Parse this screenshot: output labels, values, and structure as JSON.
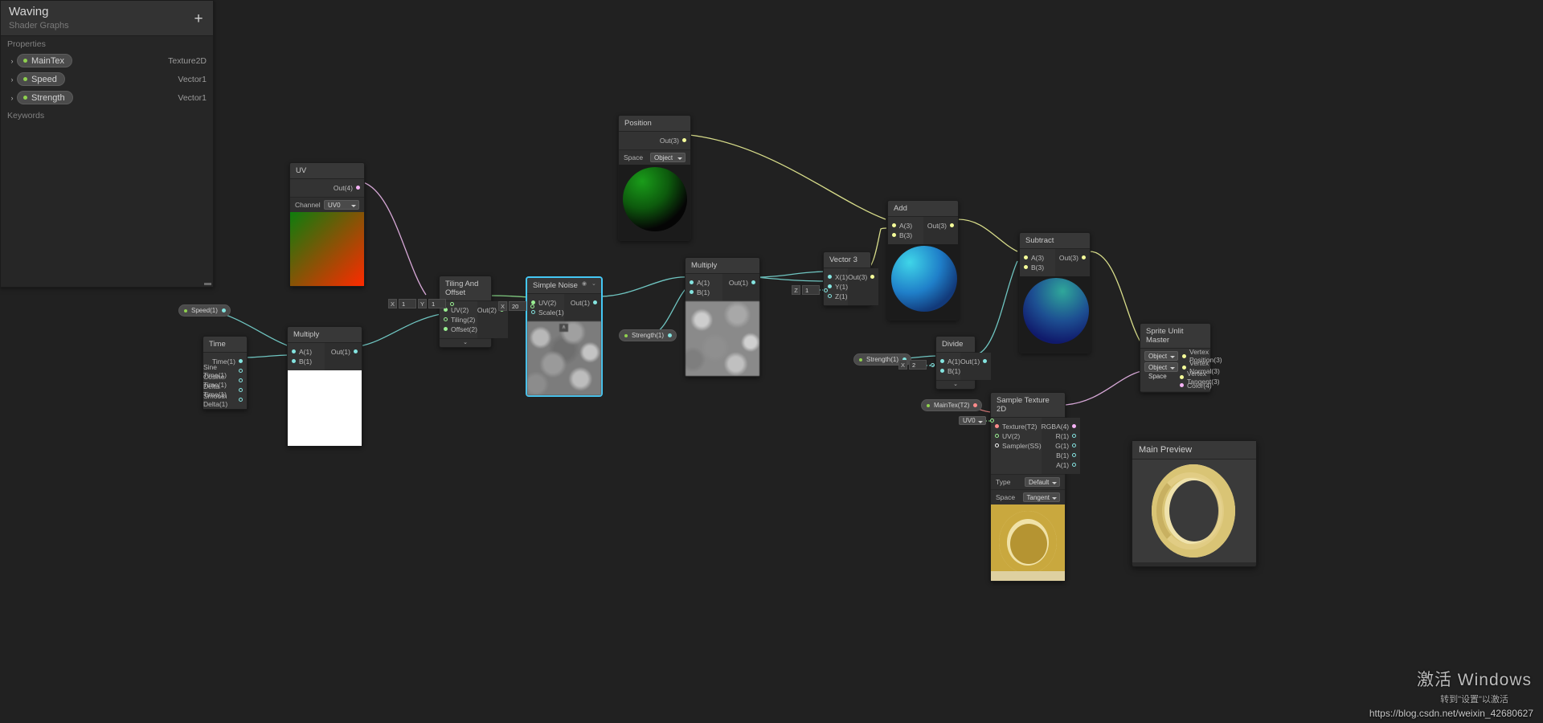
{
  "blackboard": {
    "title": "Waving",
    "subtitle": "Shader Graphs",
    "add_label": "+",
    "properties_header": "Properties",
    "keywords_header": "Keywords",
    "properties": [
      {
        "name": "MainTex",
        "type": "Texture2D",
        "arrow": "›"
      },
      {
        "name": "Speed",
        "type": "Vector1",
        "arrow": "›"
      },
      {
        "name": "Strength",
        "type": "Vector1",
        "arrow": "›"
      }
    ]
  },
  "nodes": {
    "uv": {
      "title": "UV",
      "out": "Out(4)",
      "channel_label": "Channel",
      "channel_value": "UV0"
    },
    "time": {
      "title": "Time",
      "ports": [
        "Time(1)",
        "Sine Time(1)",
        "Cosine Time(1)",
        "Delta Time(1)",
        "Smooth Delta(1)"
      ]
    },
    "multiply_time": {
      "title": "Multiply",
      "a": "A(1)",
      "b": "B(1)",
      "out": "Out(1)"
    },
    "tiling_offset": {
      "title": "Tiling And Offset",
      "in": [
        "UV(2)",
        "Tiling(2)",
        "Offset(2)"
      ],
      "out": "Out(2)",
      "collapse": "⌄"
    },
    "simple_noise": {
      "title": "Simple Noise",
      "in": [
        "UV(2)",
        "Scale(1)"
      ],
      "out": "Out(1)",
      "hdr_icons": [
        "◉",
        "⌄"
      ],
      "preview_badge": "∧"
    },
    "multiply_noise": {
      "title": "Multiply",
      "a": "A(1)",
      "b": "B(1)",
      "out": "Out(1)"
    },
    "position": {
      "title": "Position",
      "out": "Out(3)",
      "space_label": "Space",
      "space_value": "Object"
    },
    "vector3": {
      "title": "Vector 3",
      "in": [
        "X(1)",
        "Y(1)",
        "Z(1)"
      ],
      "out": "Out(3)"
    },
    "add": {
      "title": "Add",
      "a": "A(3)",
      "b": "B(3)",
      "out": "Out(3)"
    },
    "subtract": {
      "title": "Subtract",
      "a": "A(3)",
      "b": "B(3)",
      "out": "Out(3)"
    },
    "divide": {
      "title": "Divide",
      "a": "A(1)",
      "b": "B(1)",
      "out": "Out(1)",
      "collapse": "⌄"
    },
    "sample_texture": {
      "title": "Sample Texture 2D",
      "in": [
        "Texture(T2)",
        "UV(2)",
        "Sampler(SS)"
      ],
      "out": [
        "RGBA(4)",
        "R(1)",
        "G(1)",
        "B(1)",
        "A(1)"
      ],
      "type_label": "Type",
      "type_value": "Default",
      "space_label": "Space",
      "space_value": "Tangent"
    },
    "master": {
      "title": "Sprite Unlit Master",
      "space_a": "Object Space",
      "space_b": "Object Space",
      "in": [
        "Vertex Position(3)",
        "Vertex Normal(3)",
        "Vertex Tangent(3)",
        "Color(4)"
      ]
    }
  },
  "property_nodes": {
    "speed": "Speed(1)",
    "strength_noise": "Strength(1)",
    "strength_divide": "Strength(1)",
    "maintex": "MainTex(T2)"
  },
  "fields": {
    "tiling_vec": {
      "x_axis": "X",
      "x_val": "1",
      "y_axis": "Y",
      "y_val": "1"
    },
    "noise_scale": {
      "axis": "X",
      "val": "20"
    },
    "vector3_z": {
      "axis": "Z",
      "val": "1"
    },
    "divide_b": {
      "axis": "X",
      "val": "2"
    },
    "sample_uv": {
      "val": "UV0"
    }
  },
  "main_preview": {
    "title": "Main Preview"
  },
  "watermark": {
    "line1": "激活 Windows",
    "line2": "转到\"设置\"以激活",
    "blog": "https://blog.csdn.net/weixin_42680627"
  },
  "colors": {
    "background": "#212121",
    "node_body": "#2b2b2b",
    "node_header": "#383838",
    "wire_float": "#6fc5c1",
    "wire_vector2": "#7fc97f",
    "wire_vector3": "#d8dd8a",
    "wire_vector4": "#d7a8d7",
    "wire_texture": "#d87a7a",
    "selection": "#44c8f5",
    "property_dot": "#8fd14f"
  }
}
